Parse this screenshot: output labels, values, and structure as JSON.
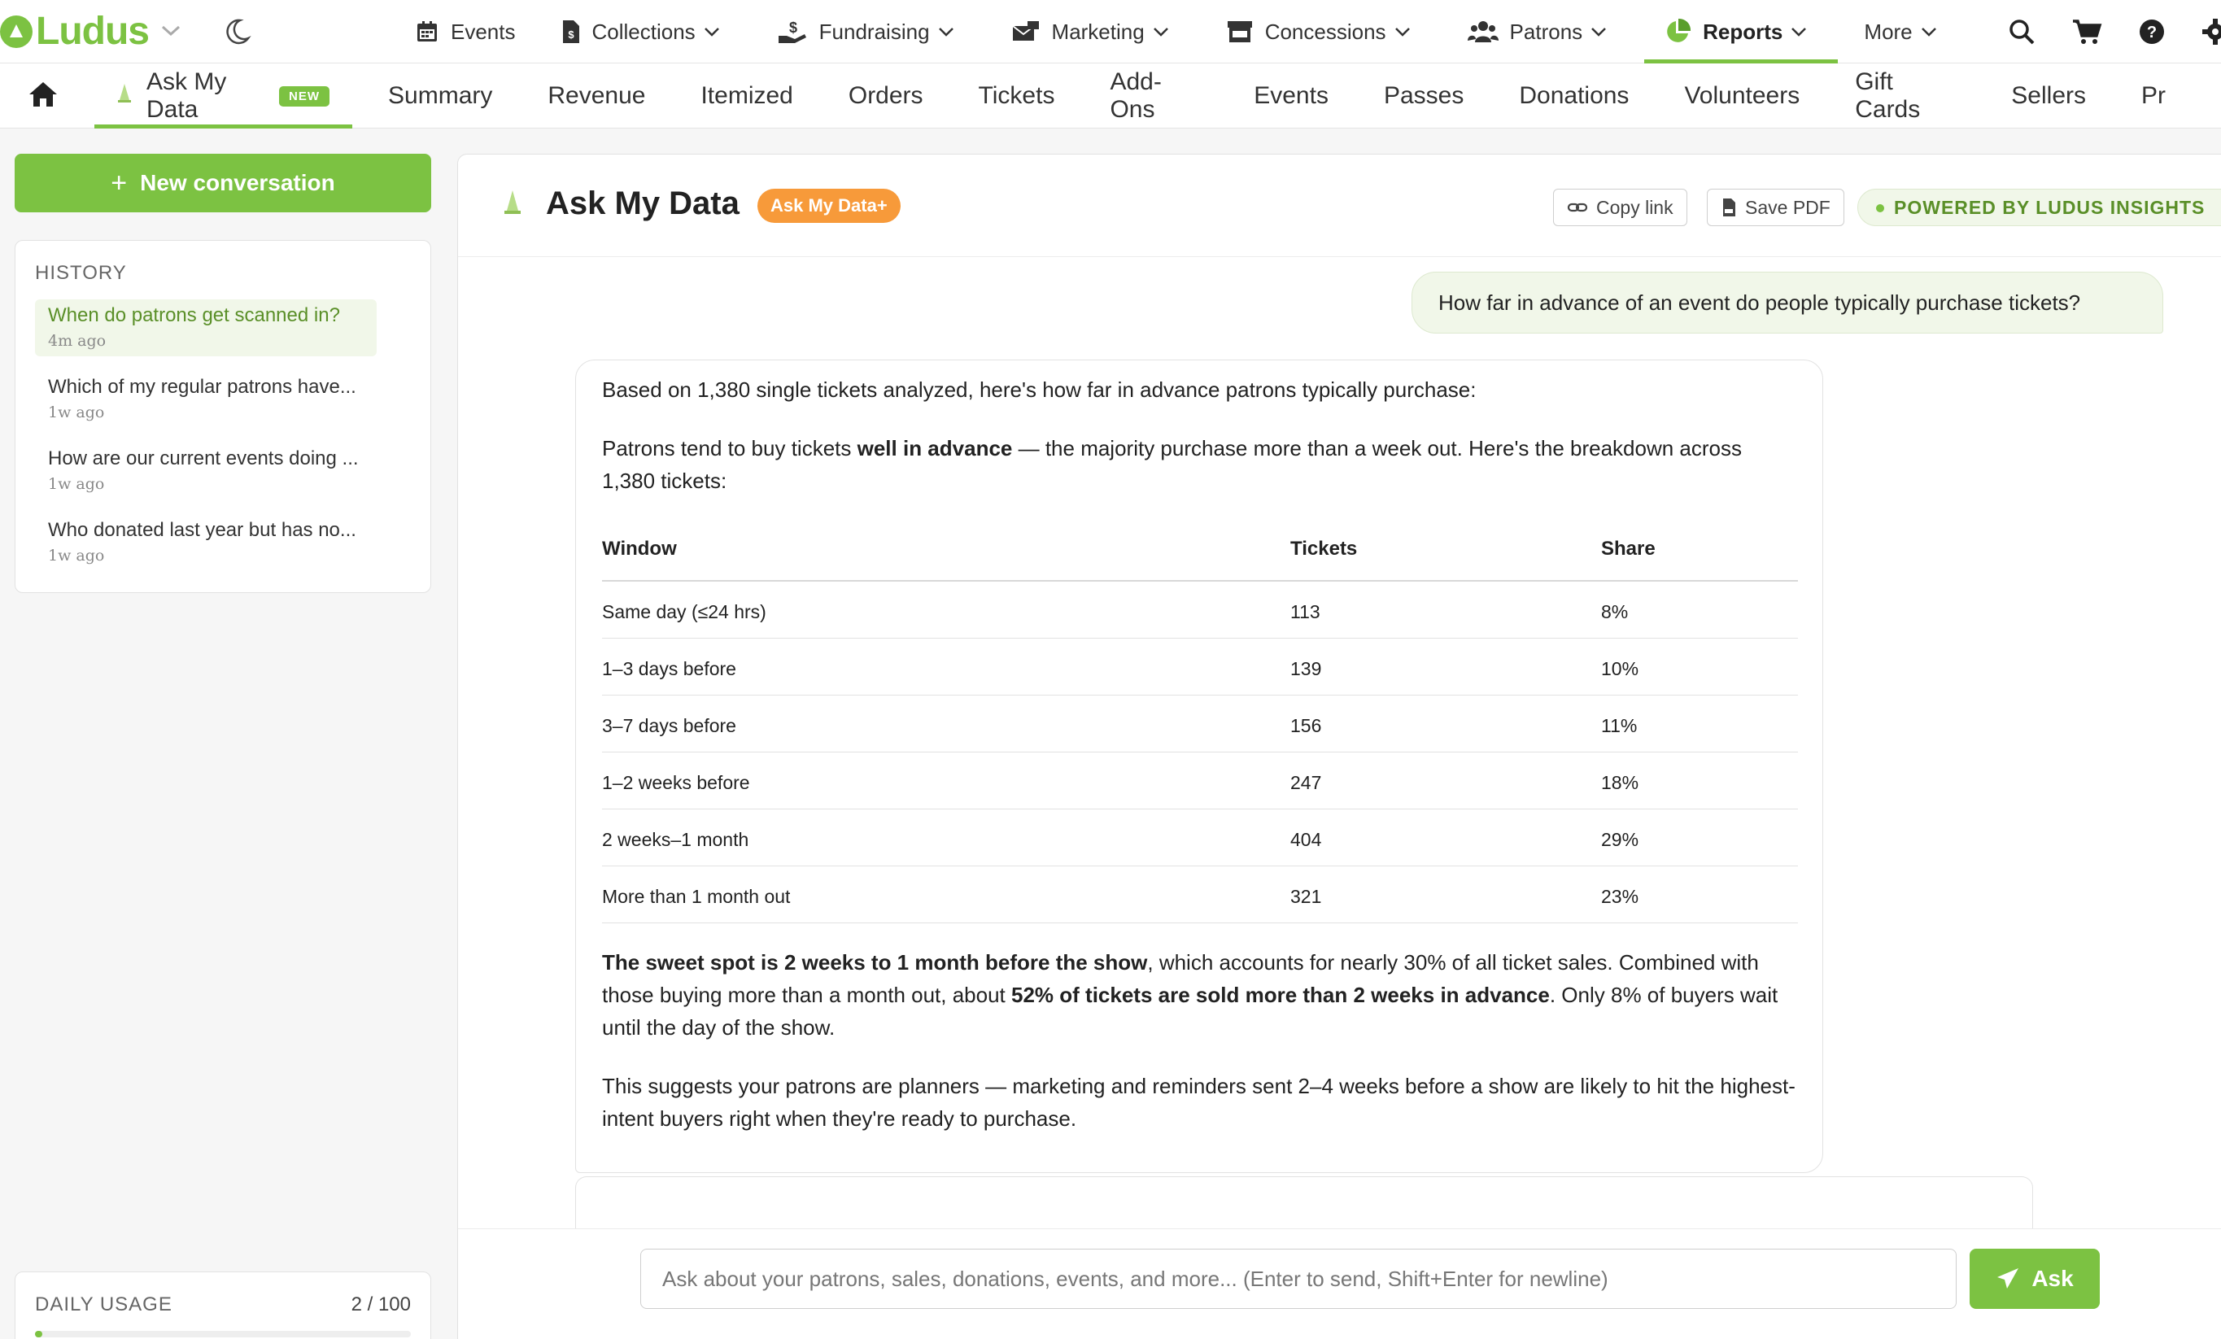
{
  "brand": {
    "name": "Ludus",
    "accent": "#7cc242",
    "orange": "#f79a3a"
  },
  "topnav": {
    "items": [
      {
        "label": "Events",
        "icon": "calendar-icon",
        "dropdown": false
      },
      {
        "label": "Collections",
        "icon": "document-icon",
        "dropdown": true
      },
      {
        "label": "Fundraising",
        "icon": "hand-dollar-icon",
        "dropdown": true
      },
      {
        "label": "Marketing",
        "icon": "envelope-icon",
        "dropdown": true
      },
      {
        "label": "Concessions",
        "icon": "store-icon",
        "dropdown": true
      },
      {
        "label": "Patrons",
        "icon": "users-icon",
        "dropdown": true
      },
      {
        "label": "Reports",
        "icon": "pie-chart-icon",
        "dropdown": true,
        "active": true
      },
      {
        "label": "More",
        "icon": "",
        "dropdown": true
      }
    ],
    "right_icons": [
      "search-icon",
      "cart-icon",
      "help-icon",
      "gear-icon"
    ]
  },
  "subnav": {
    "active_tab": "Ask My Data",
    "new_badge": "NEW",
    "tabs": [
      "Summary",
      "Revenue",
      "Itemized",
      "Orders",
      "Tickets",
      "Add-Ons",
      "Events",
      "Passes",
      "Donations",
      "Volunteers",
      "Gift Cards",
      "Sellers",
      "Pr"
    ]
  },
  "sidebar": {
    "new_conversation": "New conversation",
    "history_title": "HISTORY",
    "history": [
      {
        "q": "When do patrons get scanned in?",
        "t": "4m ago",
        "active": true
      },
      {
        "q": "Which of my regular patrons have...",
        "t": "1w ago"
      },
      {
        "q": "How are our current events doing ...",
        "t": "1w ago"
      },
      {
        "q": "Who donated last year but has no...",
        "t": "1w ago"
      }
    ],
    "usage_title": "DAILY USAGE",
    "usage_count": "2 / 100",
    "usage_fraction": 0.02
  },
  "main": {
    "title": "Ask My Data",
    "plus_badge": "Ask My Data+",
    "copy_link": "Copy link",
    "save_pdf": "Save PDF",
    "powered": "POWERED BY LUDUS INSIGHTS",
    "user_question": "How far in advance of an event do people typically purchase tickets?",
    "answer": {
      "intro": "Based on 1,380 single tickets analyzed, here's how far in advance patrons typically purchase:",
      "p2_a": "Patrons tend to buy tickets ",
      "p2_b": "well in advance",
      "p2_c": " — the majority purchase more than a week out. Here's the breakdown across 1,380 tickets:",
      "table_headers": [
        "Window",
        "Tickets",
        "Share"
      ],
      "rows": [
        [
          "Same day (≤24 hrs)",
          "113",
          "8%"
        ],
        [
          "1–3 days before",
          "139",
          "10%"
        ],
        [
          "3–7 days before",
          "156",
          "11%"
        ],
        [
          "1–2 weeks before",
          "247",
          "18%"
        ],
        [
          "2 weeks–1 month",
          "404",
          "29%"
        ],
        [
          "More than 1 month out",
          "321",
          "23%"
        ]
      ],
      "p3_a": "The sweet spot is 2 weeks to 1 month before the show",
      "p3_b": ", which accounts for nearly 30% of all ticket sales. Combined with those buying more than a month out, about ",
      "p3_c": "52% of tickets are sold more than 2 weeks in advance",
      "p3_d": ". Only 8% of buyers wait until the day of the show.",
      "p4": "This suggests your patrons are planners — marketing and reminders sent 2–4 weeks before a show are likely to hit the highest-intent buyers right when they're ready to purchase."
    },
    "composer_placeholder": "Ask about your patrons, sales, donations, events, and more... (Enter to send, Shift+Enter for newline)",
    "ask_label": "Ask"
  }
}
